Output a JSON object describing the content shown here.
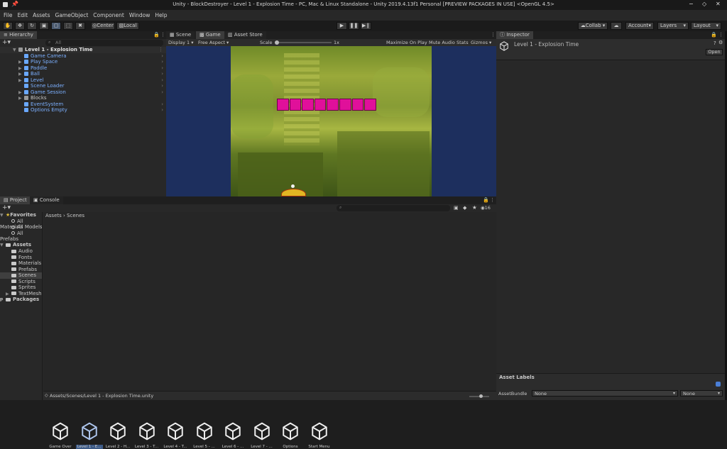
{
  "window": {
    "title": "Unity - BlockDestroyer - Level 1 - Explosion Time - PC, Mac & Linux Standalone - Unity 2019.4.13f1 Personal [PREVIEW PACKAGES IN USE] <OpenGL 4.5>",
    "controls": [
      "−",
      "◇",
      "✕"
    ]
  },
  "menu": [
    "File",
    "Edit",
    "Assets",
    "GameObject",
    "Component",
    "Window",
    "Help"
  ],
  "toolbar": {
    "pivot": "Center",
    "space": "Local",
    "collab": "Collab ▾",
    "account": "Account",
    "layers": "Layers",
    "layout": "Layout"
  },
  "hierarchy": {
    "tab": "Hierarchy",
    "search_placeholder": "All",
    "scene": "Level 1 - Explosion Time",
    "items": [
      {
        "label": "Game Camera",
        "expandable": false
      },
      {
        "label": "Play Space",
        "expandable": true
      },
      {
        "label": "Paddle",
        "expandable": true
      },
      {
        "label": "Ball",
        "expandable": true
      },
      {
        "label": "Level",
        "expandable": true
      },
      {
        "label": "Scene Loader",
        "expandable": false
      },
      {
        "label": "Game Session",
        "expandable": true
      },
      {
        "label": "Blocks",
        "expandable": true
      },
      {
        "label": "EventSystem",
        "expandable": false
      },
      {
        "label": "Options Empty",
        "expandable": false
      }
    ]
  },
  "game_view": {
    "tabs": [
      "Scene",
      "Game",
      "Asset Store"
    ],
    "display": "Display 1",
    "aspect": "Free Aspect",
    "scale_label": "Scale",
    "scale_value": "1x",
    "options": [
      "Maximize On Play",
      "Mute Audio",
      "Stats",
      "Gizmos"
    ],
    "block_color": "#e0109a",
    "block_count": 8
  },
  "inspector": {
    "tab": "Inspector",
    "title": "Level 1 - Explosion Time",
    "open_button": "Open",
    "asset_labels": "Asset Labels",
    "asset_bundle_label": "AssetBundle",
    "asset_bundle_value": "None",
    "asset_bundle_variant": "None"
  },
  "project": {
    "tabs": [
      "Project",
      "Console"
    ],
    "favorites_label": "Favorites",
    "favorites": [
      "All Materials",
      "All Models",
      "All Prefabs"
    ],
    "assets_label": "Assets",
    "asset_folders": [
      "Audio",
      "Fonts",
      "Materials",
      "Prefabs",
      "Scenes",
      "Scripts",
      "Sprites",
      "TextMesh P"
    ],
    "packages_label": "Packages",
    "breadcrumb": [
      "Assets",
      "Scenes"
    ],
    "hidden_count": "16",
    "scenes": [
      {
        "label": "Game Over",
        "selected": false
      },
      {
        "label": "Level 1 - E...",
        "selected": true
      },
      {
        "label": "Level 2 - H...",
        "selected": false
      },
      {
        "label": "Level 3 - T...",
        "selected": false
      },
      {
        "label": "Level 4 - T...",
        "selected": false
      },
      {
        "label": "Level 5 - ...",
        "selected": false
      },
      {
        "label": "Level 6 - ...",
        "selected": false
      },
      {
        "label": "Level 7 - ...",
        "selected": false
      },
      {
        "label": "Options",
        "selected": false
      },
      {
        "label": "Start Menu",
        "selected": false
      }
    ],
    "status_path": "Assets/Scenes/Level 1 - Explosion Time.unity"
  }
}
